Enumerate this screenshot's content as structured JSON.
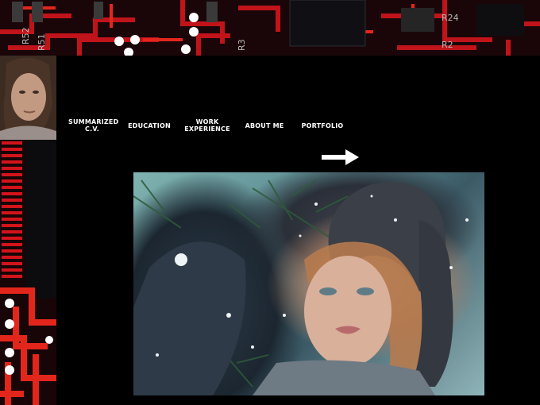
{
  "nav": {
    "items": [
      {
        "line1": "SUMMARIZED",
        "line2": "C.V."
      },
      {
        "line1": "EDUCATION",
        "line2": ""
      },
      {
        "line1": "WORK",
        "line2": "EXPERIENCE"
      },
      {
        "line1": "ABOUT ME",
        "line2": ""
      },
      {
        "line1": "PORTFOLIO",
        "line2": ""
      }
    ]
  },
  "header": {
    "pcb_labels": [
      "R52",
      "R51",
      "R3",
      "R24",
      "R2"
    ]
  },
  "icons": {
    "arrow": "arrow-right-icon",
    "avatar": "profile-photo"
  },
  "colors": {
    "background": "#000000",
    "pcb_red": "#d01218",
    "nav_text": "#ffffff"
  }
}
